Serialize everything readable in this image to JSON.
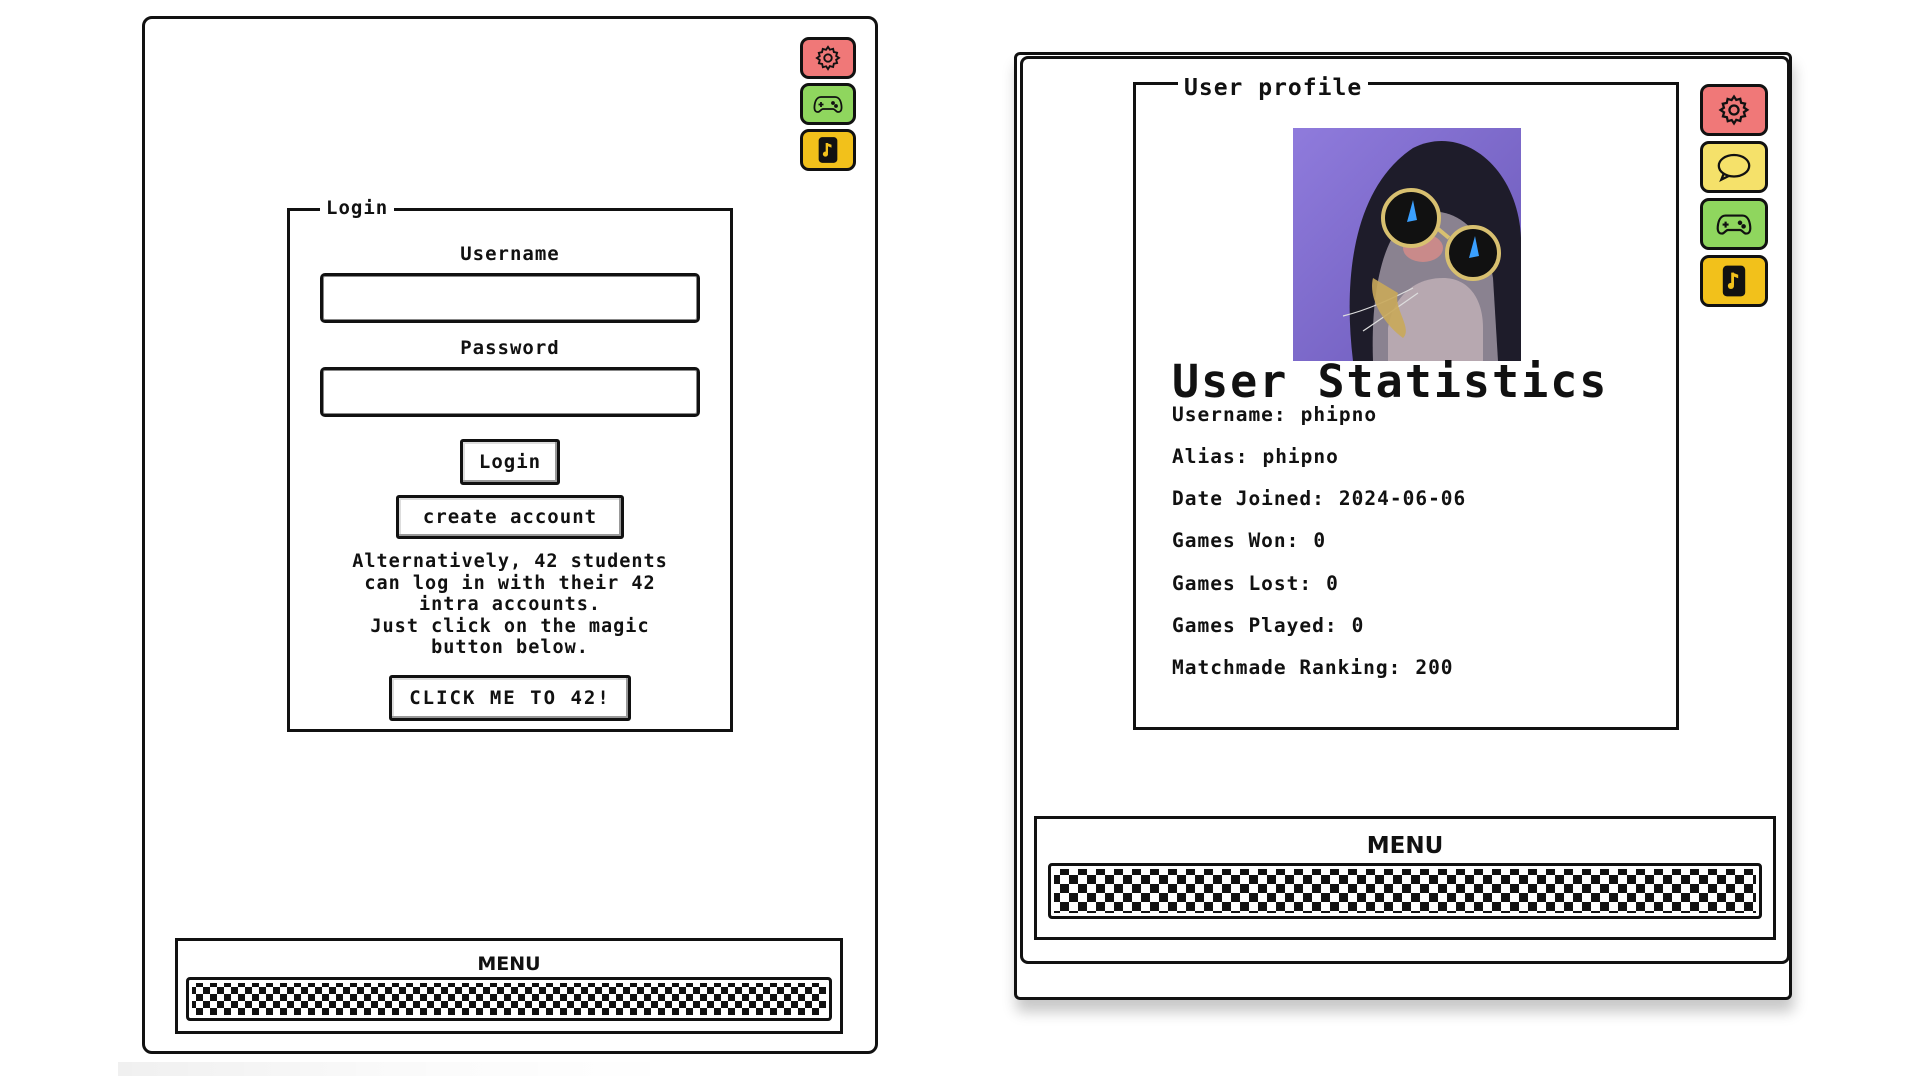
{
  "colors": {
    "settings": "#f07878",
    "game": "#8fd65e",
    "music": "#f2c11b",
    "chat": "#f5e16a"
  },
  "login_view": {
    "side_icons": [
      "gear-icon",
      "gamepad-icon",
      "music-note-icon"
    ],
    "panel_title": "Login",
    "username_label": "Username",
    "username_value": "",
    "password_label": "Password",
    "password_value": "",
    "login_button": "Login",
    "create_account_button": "create account",
    "note": "Alternatively, 42 students\ncan log in with their 42\nintra accounts.\nJust click on the magic\nbutton below.",
    "intra_button": "CLICK ME TO 42!",
    "menu_label": "MENU"
  },
  "profile_view": {
    "side_icons": [
      "gear-icon",
      "chat-bubble-icon",
      "gamepad-icon",
      "music-note-icon"
    ],
    "panel_title": "User profile",
    "stats_title": "User Statistics",
    "stats": [
      {
        "label": "Username:",
        "value": "phipno"
      },
      {
        "label": "Alias:",
        "value": "phipno"
      },
      {
        "label": "Date Joined:",
        "value": "2024-06-06"
      },
      {
        "label": "Games Won:",
        "value": "0"
      },
      {
        "label": "Games Lost:",
        "value": "0"
      },
      {
        "label": "Games Played:",
        "value": "0"
      },
      {
        "label": "Matchmade Ranking:",
        "value": "200"
      }
    ],
    "menu_label": "MENU"
  }
}
